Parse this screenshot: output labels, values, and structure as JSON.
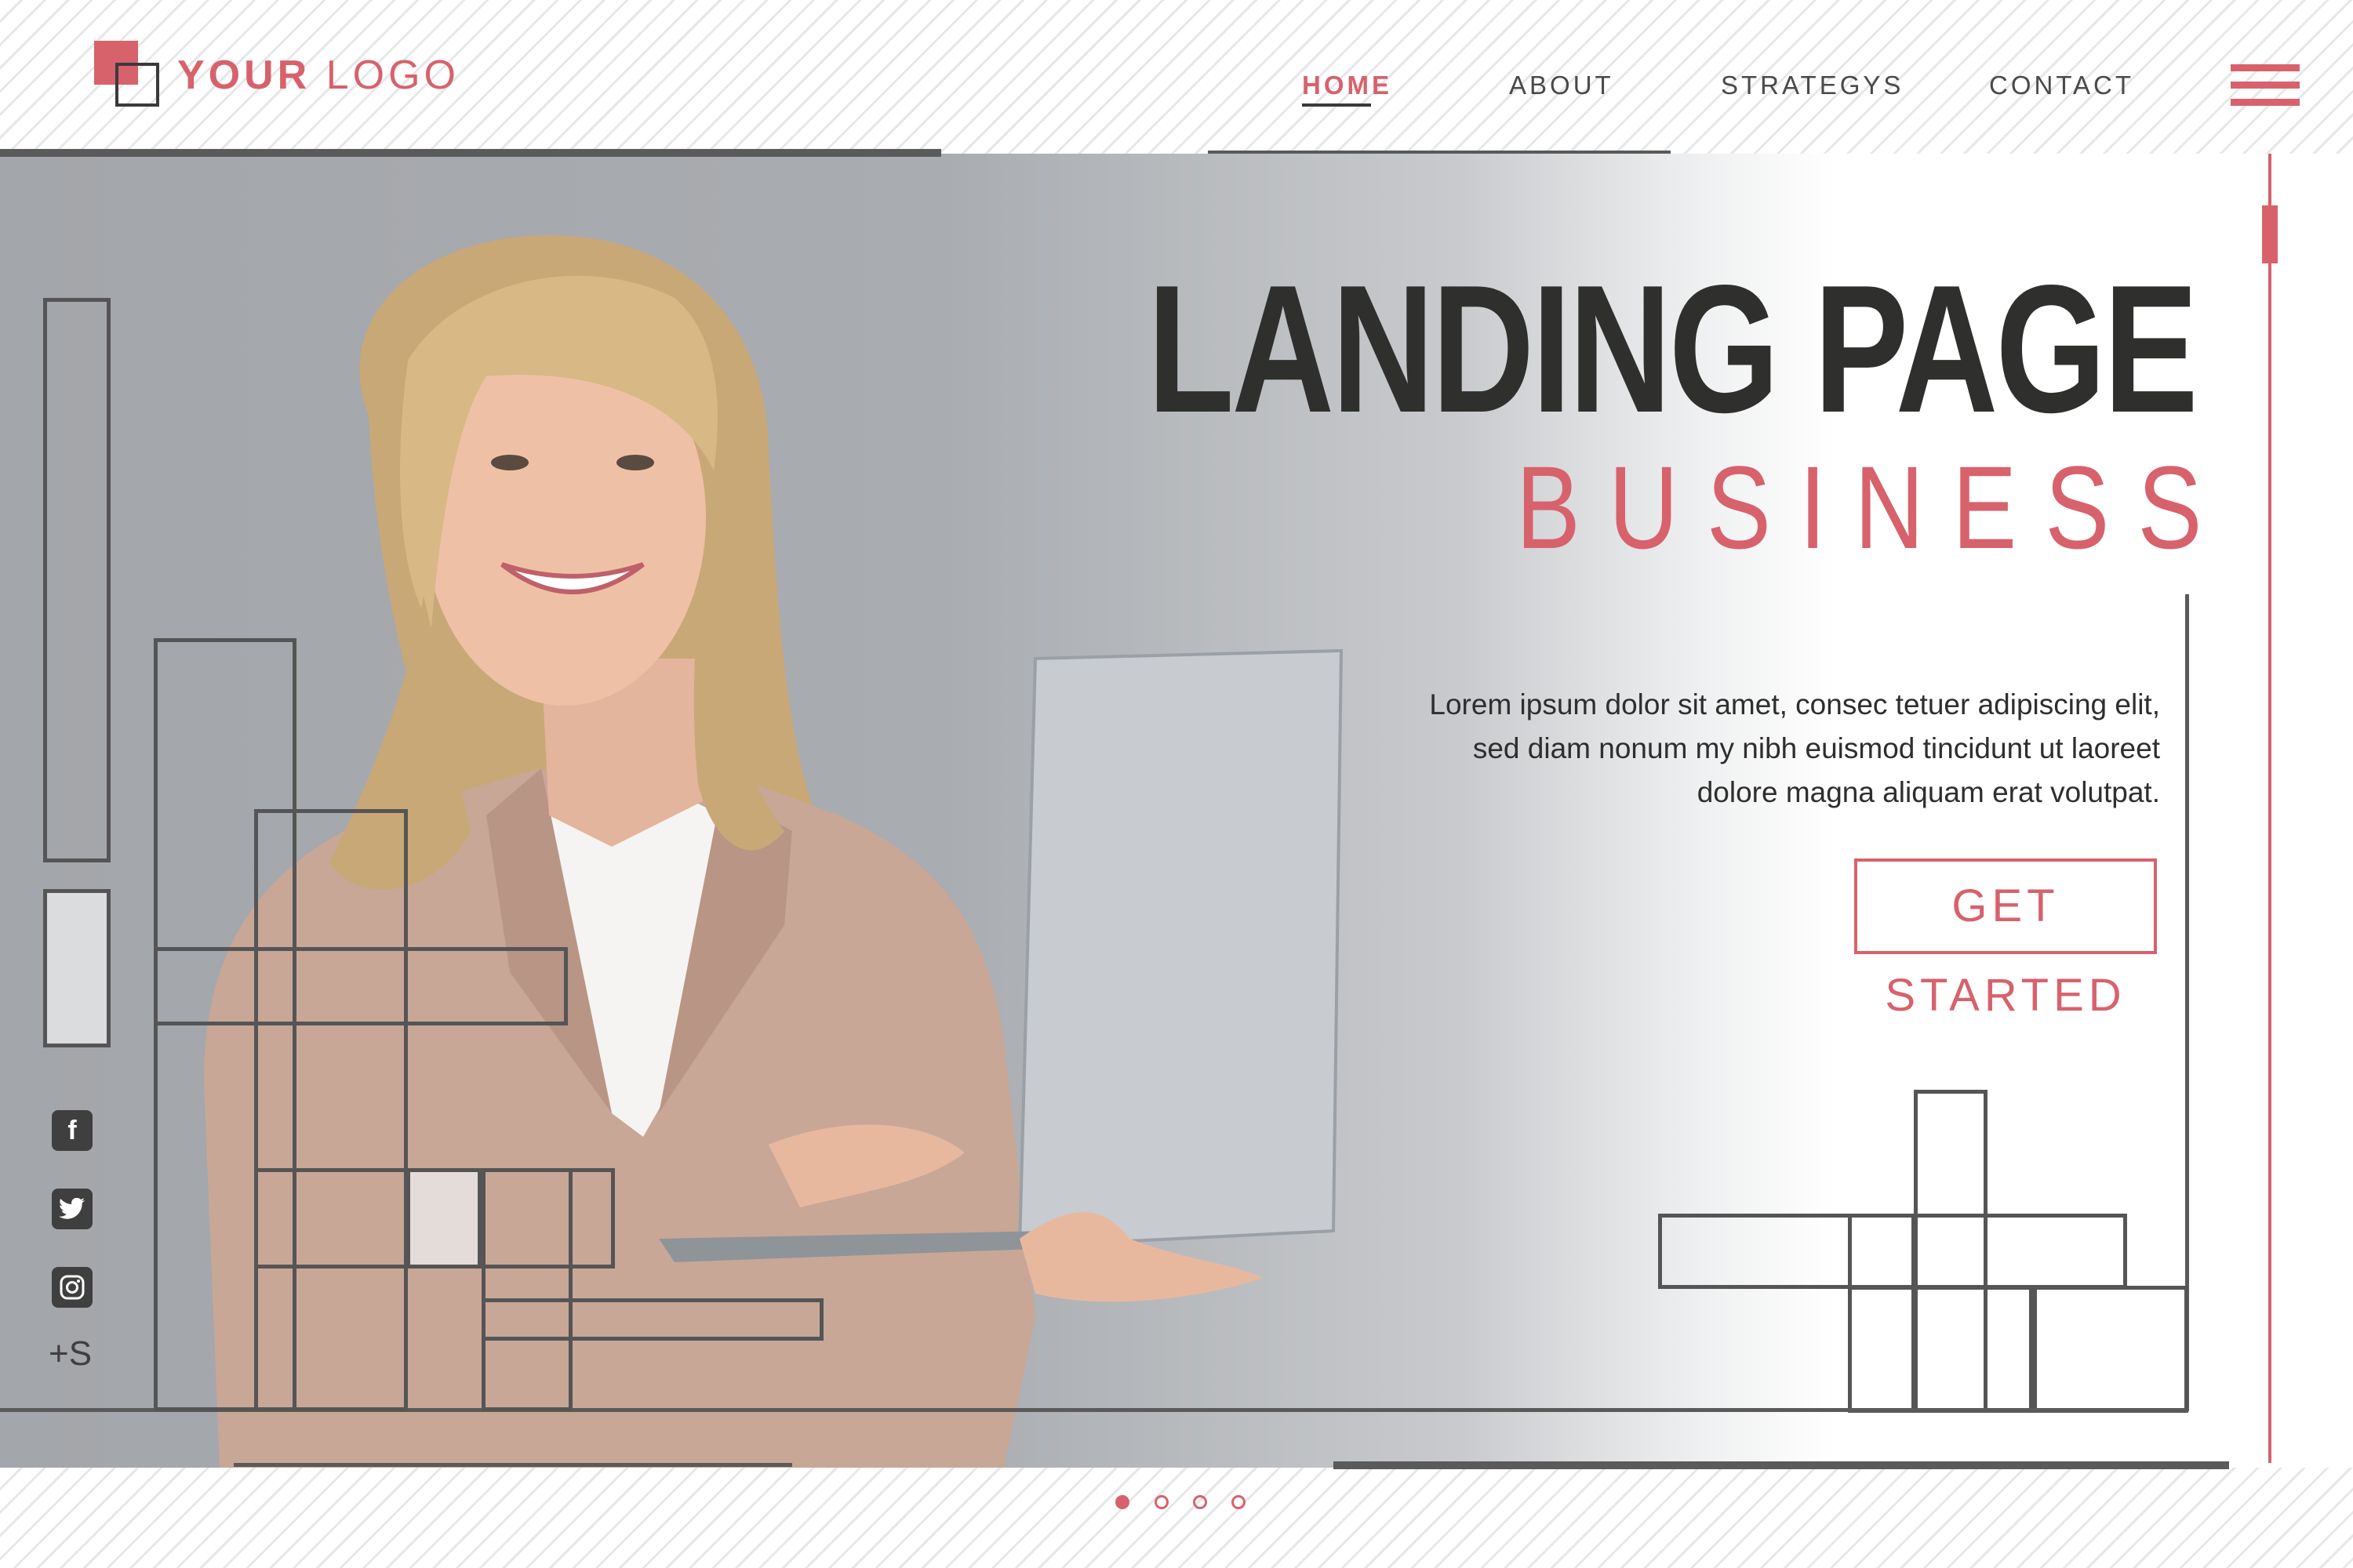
{
  "logo": {
    "bold": "YOUR",
    "light": "LOGO"
  },
  "nav": [
    {
      "label": "HOME",
      "active": true
    },
    {
      "label": "ABOUT",
      "active": false
    },
    {
      "label": "STRATEGYS",
      "active": false
    },
    {
      "label": "CONTACT",
      "active": false
    }
  ],
  "hero": {
    "title": "LANDING PAGE",
    "subtitle": "BUSINESS",
    "description": "Lorem ipsum dolor sit amet, consec tetuer adipiscing elit, sed diam nonum my nibh euismod tincidunt ut laoreet dolore magna aliquam erat volutpat.",
    "cta_label": "GET STARTED"
  },
  "social": {
    "icons": [
      "facebook-icon",
      "twitter-icon",
      "instagram-icon"
    ],
    "more_label": "+S"
  },
  "slider": {
    "page_count": 4,
    "active_index": 0
  },
  "colors": {
    "accent": "#d7626c",
    "dark": "#2f2f2d",
    "line": "#5a5a5a",
    "hero_gray": "#a3a6aa"
  }
}
